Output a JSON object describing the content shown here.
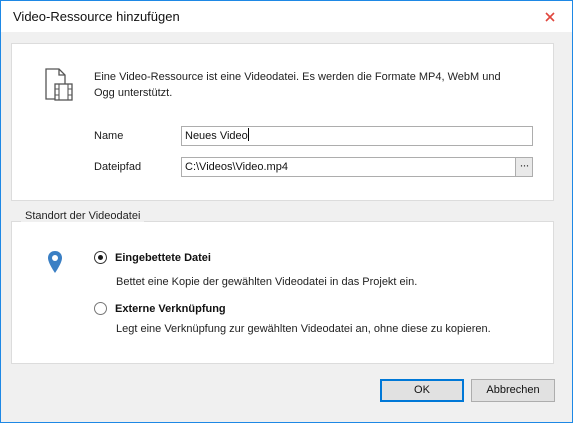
{
  "window": {
    "title": "Video-Ressource hinzufügen",
    "close_icon": "close-icon"
  },
  "resource": {
    "icon": "video-file-icon",
    "intro": "Eine Video-Ressource ist eine Videodatei. Es werden die Formate MP4, WebM und Ogg unterstützt.",
    "name_label": "Name",
    "name_value": "Neues Video",
    "path_label": "Dateipfad",
    "path_value": "C:\\Videos\\Video.mp4",
    "browse_label": "···"
  },
  "location": {
    "group_label": "Standort der Videodatei",
    "icon": "location-pin-icon",
    "embedded_label": "Eingebettete Datei",
    "embedded_desc": "Bettet eine Kopie der gewählten Videodatei in das Projekt ein.",
    "embedded_selected": true,
    "external_label": "Externe Verknüpfung",
    "external_desc": "Legt eine Verknüpfung zur gewählten Videodatei an, ohne diese zu kopieren.",
    "external_selected": false
  },
  "buttons": {
    "ok_label": "OK",
    "cancel_label": "Abbrechen"
  },
  "colors": {
    "accent": "#1e88e5",
    "pin": "#3a7fc4",
    "close": "#e0463d"
  }
}
